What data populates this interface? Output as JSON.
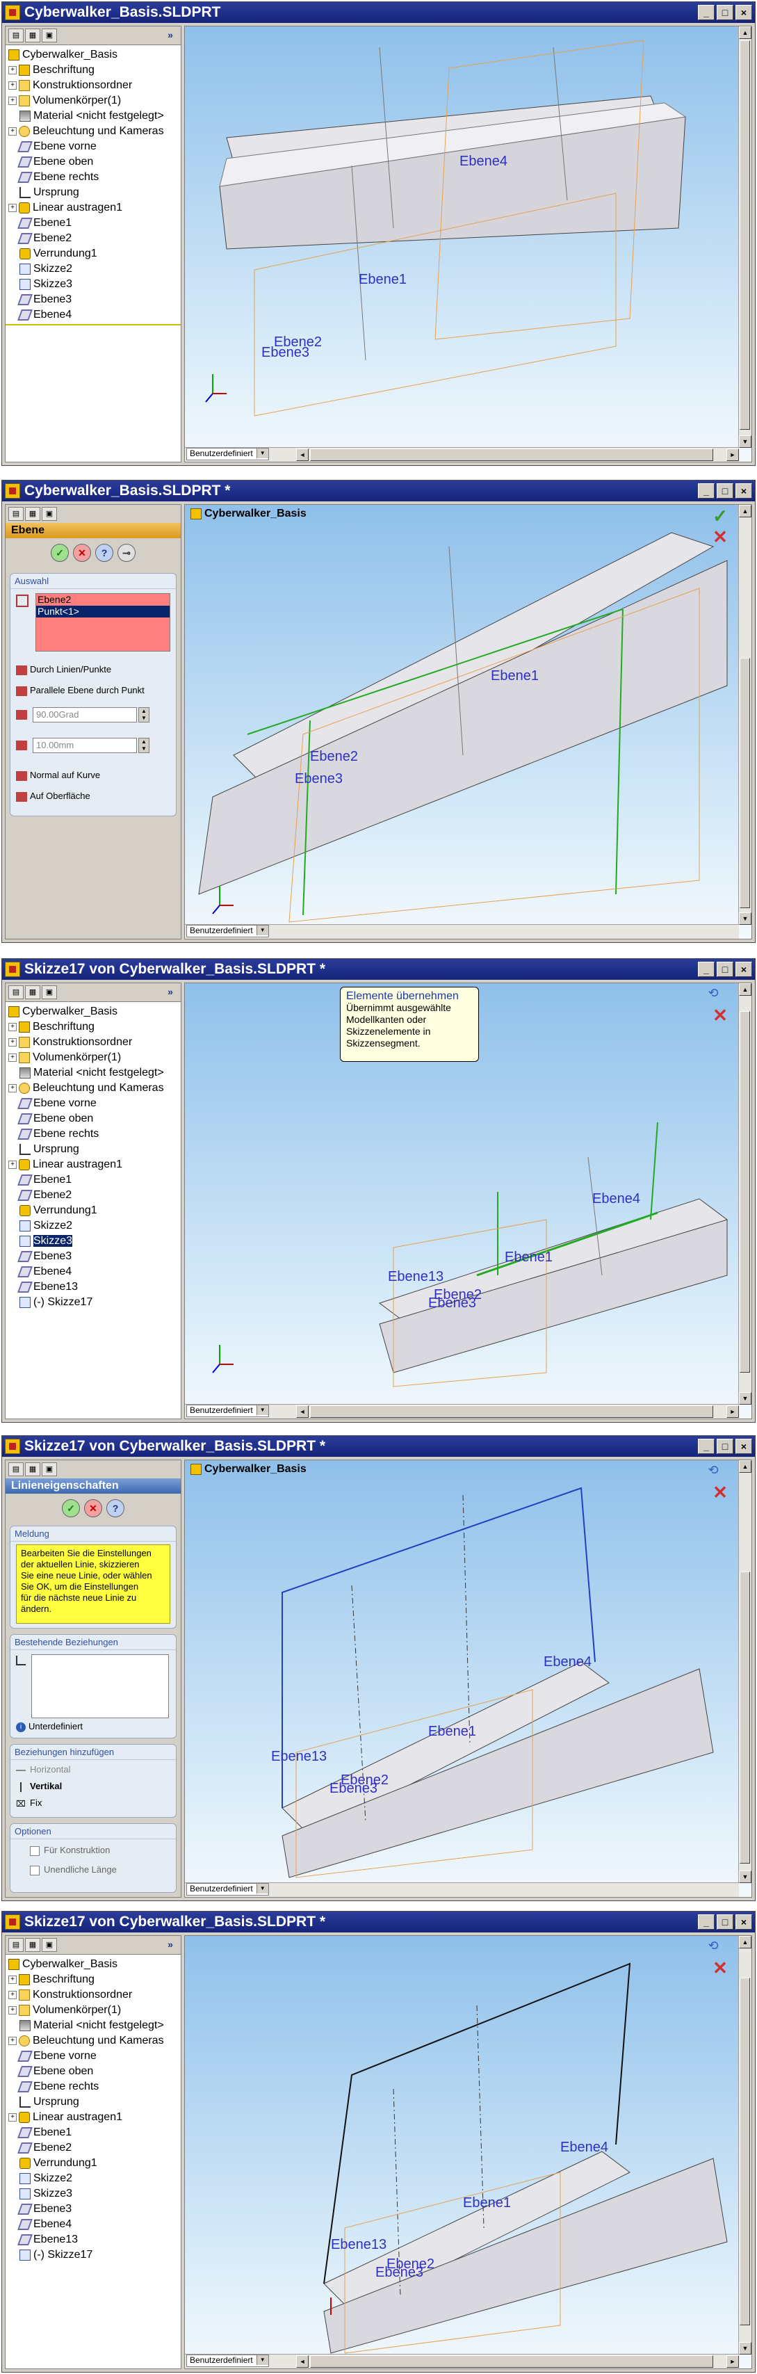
{
  "panels": [
    {
      "title": "Cyberwalker_Basis.SLDPRT",
      "tree": [
        "Cyberwalker_Basis",
        "Beschriftung",
        "Konstruktionsordner",
        "Volumenkörper(1)",
        "Material <nicht festgelegt>",
        "Beleuchtung und Kameras",
        "Ebene vorne",
        "Ebene oben",
        "Ebene rechts",
        "Ursprung",
        "Linear austragen1",
        "Ebene1",
        "Ebene2",
        "Verrundung1",
        "Skizze2",
        "Skizze3",
        "Ebene3",
        "Ebene4"
      ],
      "labels": [
        "Ebene4",
        "Ebene1",
        "Ebene2",
        "Ebene3"
      ],
      "view": "Benutzerdefiniert"
    },
    {
      "title": "Cyberwalker_Basis.SLDPRT *",
      "viewport_title": "Cyberwalker_Basis",
      "pm_title": "Ebene",
      "group_title": "Auswahl",
      "selection": [
        "Ebene2",
        "Punkt<1>"
      ],
      "options": [
        "Durch Linien/Punkte",
        "Parallele Ebene durch Punkt"
      ],
      "angle": "90.00Grad",
      "distance": "10.00mm",
      "options2": [
        "Normal auf Kurve",
        "Auf Oberfläche"
      ],
      "labels": [
        "Ebene1",
        "Ebene2",
        "Ebene3"
      ],
      "view": "Benutzerdefiniert"
    },
    {
      "title": "Skizze17 von Cyberwalker_Basis.SLDPRT *",
      "tree": [
        "Cyberwalker_Basis",
        "Beschriftung",
        "Konstruktionsordner",
        "Volumenkörper(1)",
        "Material <nicht festgelegt>",
        "Beleuchtung und Kameras",
        "Ebene vorne",
        "Ebene oben",
        "Ebene rechts",
        "Ursprung",
        "Linear austragen1",
        "Ebene1",
        "Ebene2",
        "Verrundung1",
        "Skizze2",
        "Skizze3",
        "Ebene3",
        "Ebene4",
        "Ebene13",
        "(-) Skizze17"
      ],
      "tooltip_title": "Elemente übernehmen",
      "tooltip_text": [
        "Übernimmt ausgewählte",
        "Modellkanten oder",
        "Skizzenelemente in",
        "Skizzensegment."
      ],
      "labels": [
        "Ebene4",
        "Ebene1",
        "Ebene13",
        "Ebene2",
        "Ebene3"
      ],
      "view": "Benutzerdefiniert"
    },
    {
      "title": "Skizze17 von Cyberwalker_Basis.SLDPRT *",
      "viewport_title": "Cyberwalker_Basis",
      "pm_title": "Linieneigenschaften",
      "msg_title": "Meldung",
      "message": [
        "Bearbeiten Sie die Einstellungen",
        "der aktuellen Linie, skizzieren",
        "Sie eine neue Linie, oder wählen",
        "Sie OK, um die Einstellungen",
        "für die nächste neue Linie zu",
        "ändern."
      ],
      "rel_title": "Bestehende Beziehungen",
      "status": "Unterdefiniert",
      "add_title": "Beziehungen hinzufügen",
      "add_items": [
        "Horizontal",
        "Vertikal",
        "Fix"
      ],
      "opt_title": "Optionen",
      "opt_items": [
        "Für Konstruktion",
        "Unendliche Länge"
      ],
      "labels": [
        "Ebene4",
        "Ebene1",
        "Ebene13",
        "Ebene2",
        "Ebene3"
      ],
      "view": "Benutzerdefiniert"
    },
    {
      "title": "Skizze17 von Cyberwalker_Basis.SLDPRT *",
      "tree": [
        "Cyberwalker_Basis",
        "Beschriftung",
        "Konstruktionsordner",
        "Volumenkörper(1)",
        "Material <nicht festgelegt>",
        "Beleuchtung und Kameras",
        "Ebene vorne",
        "Ebene oben",
        "Ebene rechts",
        "Ursprung",
        "Linear austragen1",
        "Ebene1",
        "Ebene2",
        "Verrundung1",
        "Skizze2",
        "Skizze3",
        "Ebene3",
        "Ebene4",
        "Ebene13",
        "(-) Skizze17"
      ],
      "labels": [
        "Ebene4",
        "Ebene1",
        "Ebene13",
        "Ebene2",
        "Ebene3"
      ],
      "view": "Benutzerdefiniert"
    }
  ]
}
